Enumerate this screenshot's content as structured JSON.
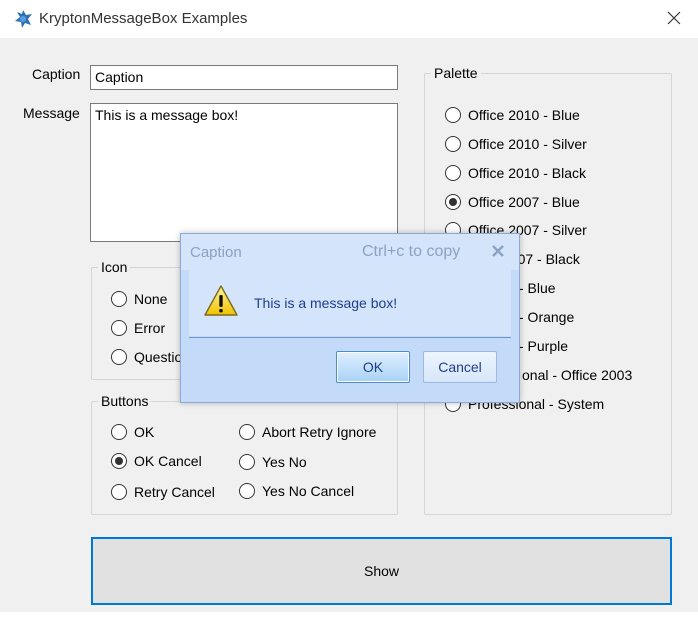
{
  "window": {
    "title": "KryptonMessageBox Examples"
  },
  "form": {
    "caption_label": "Caption",
    "caption_value": "Caption",
    "message_label": "Message",
    "message_value": "This is a message box!"
  },
  "icon_group": {
    "title": "Icon",
    "options": [
      {
        "label": "None",
        "checked": false
      },
      {
        "label": "Error",
        "checked": false
      },
      {
        "label": "Questio",
        "checked": false
      }
    ]
  },
  "buttons_group": {
    "title": "Buttons",
    "options": [
      {
        "label": "OK",
        "checked": false
      },
      {
        "label": "OK Cancel",
        "checked": true
      },
      {
        "label": "Retry Cancel",
        "checked": false
      },
      {
        "label": "Abort Retry Ignore",
        "checked": false
      },
      {
        "label": "Yes No",
        "checked": false
      },
      {
        "label": "Yes No Cancel",
        "checked": false
      }
    ]
  },
  "palette_group": {
    "title": "Palette",
    "options": [
      {
        "label": "Office 2010 - Blue",
        "checked": false
      },
      {
        "label": "Office 2010 - Silver",
        "checked": false
      },
      {
        "label": "Office 2010 - Black",
        "checked": false
      },
      {
        "label": "Office 2007 - Blue",
        "checked": true
      },
      {
        "label": "Office 2007 - Silver",
        "checked": false
      },
      {
        "label": "2007 - Black",
        "checked": false
      },
      {
        "label": "- Blue",
        "checked": false
      },
      {
        "label": "- Orange",
        "checked": false
      },
      {
        "label": "- Purple",
        "checked": false
      },
      {
        "label": "onal - Office 2003",
        "checked": false
      },
      {
        "label": "Professional - System",
        "checked": false
      }
    ]
  },
  "show_button": "Show",
  "message_box": {
    "caption": "Caption",
    "copy_hint": "Ctrl+c to copy",
    "text": "This is a message box!",
    "ok_label": "OK",
    "cancel_label": "Cancel",
    "icon": "warning-icon"
  },
  "colors": {
    "accent": "#0078d7",
    "dialog_bg": "#c3daf9",
    "dialog_text": "#1e3e8c"
  }
}
